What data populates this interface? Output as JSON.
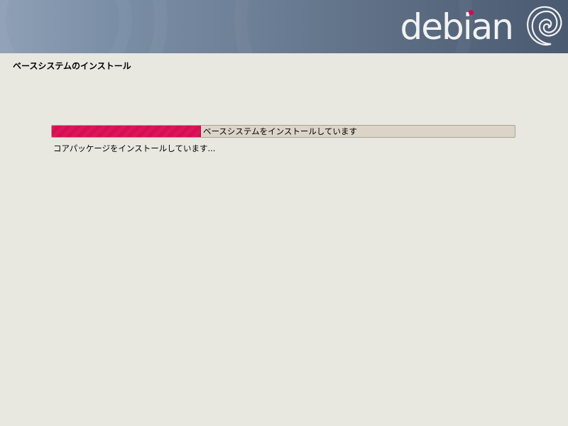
{
  "banner": {
    "logo_text": "debian",
    "logo_dot_color": "#d70751",
    "swirl_icon": "debian-swirl-icon"
  },
  "page": {
    "title": "ベースシステムのインストール"
  },
  "progress": {
    "label": "ベースシステムをインストールしています",
    "fraction": 0.32,
    "fill_color": "#e0145a"
  },
  "status": {
    "text": "コアパッケージをインストールしています..."
  }
}
